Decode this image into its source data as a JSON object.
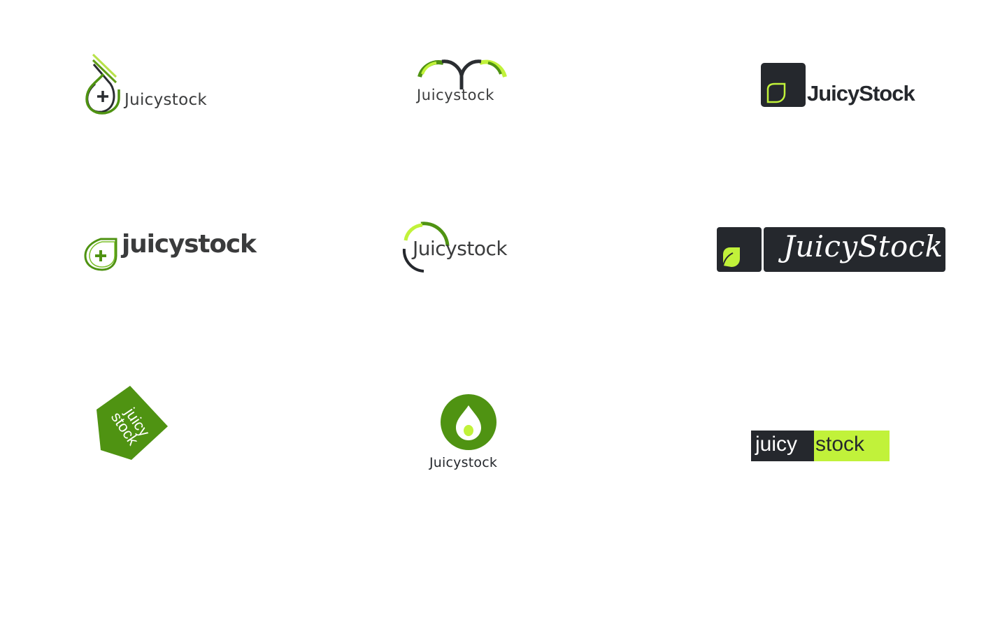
{
  "logos": [
    {
      "id": 1,
      "text": "Juicystock",
      "icon": "plus-drop-icon"
    },
    {
      "id": 2,
      "text": "Juicystock",
      "icon": "arches-y-icon"
    },
    {
      "id": 3,
      "text": "JuicyStock",
      "icon": "square-leaf-icon"
    },
    {
      "id": 4,
      "text": "juicystock",
      "icon": "plus-drop-icon"
    },
    {
      "id": 5,
      "text": "Juicystock",
      "icon": "ring-arc-icon"
    },
    {
      "id": 6,
      "text": "JuicyStock",
      "icon": "leaf-tile-icon"
    },
    {
      "id": 7,
      "text": "juicy stock",
      "icon": "tag-icon"
    },
    {
      "id": 8,
      "text": "Juicystock",
      "icon": "circle-drop-icon"
    },
    {
      "id": 9,
      "text_left": "juicy",
      "text_right": "stock"
    }
  ],
  "colors": {
    "dark": "#25282d",
    "text_gray": "#3b3c3d",
    "green": "#4f9312",
    "lime": "#c1f23a"
  }
}
